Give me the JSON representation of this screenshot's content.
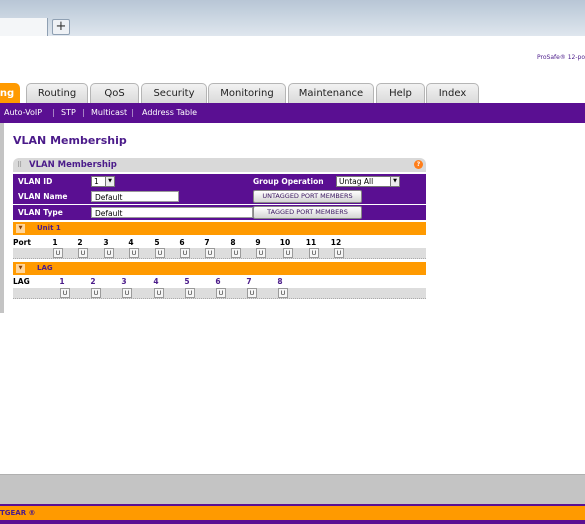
{
  "product_label": "ProSafe® 12-po",
  "main_tabs": [
    {
      "label": "ng",
      "active": true
    },
    {
      "label": "Routing",
      "active": false
    },
    {
      "label": "QoS",
      "active": false
    },
    {
      "label": "Security",
      "active": false
    },
    {
      "label": "Monitoring",
      "active": false
    },
    {
      "label": "Maintenance",
      "active": false
    },
    {
      "label": "Help",
      "active": false
    },
    {
      "label": "Index",
      "active": false
    }
  ],
  "subnav": {
    "items": [
      "Auto-VoIP",
      "STP",
      "Multicast",
      "Address Table"
    ],
    "separator": "|"
  },
  "page_title": "VLAN Membership",
  "panel": {
    "title": "VLAN Membership",
    "help_icon": "?",
    "vlan_id_label": "VLAN ID",
    "vlan_id_value": "1",
    "group_operation_label": "Group Operation",
    "group_operation_value": "Untag All",
    "vlan_name_label": "VLAN Name",
    "vlan_name_value": "Default",
    "vlan_type_label": "VLAN Type",
    "vlan_type_value": "Default",
    "untagged_button": "UNTAGGED PORT MEMBERS",
    "tagged_button": "TAGGED PORT MEMBERS"
  },
  "unit": {
    "section_label": "Unit 1",
    "row_label": "Port",
    "ports": [
      "1",
      "2",
      "3",
      "4",
      "5",
      "6",
      "7",
      "8",
      "9",
      "10",
      "11",
      "12"
    ],
    "states": [
      "U",
      "U",
      "U",
      "U",
      "U",
      "U",
      "U",
      "U",
      "U",
      "U",
      "U",
      "U"
    ]
  },
  "lag": {
    "section_label": "LAG",
    "row_label": "LAG",
    "lags": [
      "1",
      "2",
      "3",
      "4",
      "5",
      "6",
      "7",
      "8"
    ],
    "states": [
      "U",
      "U",
      "U",
      "U",
      "U",
      "U",
      "U",
      "U"
    ]
  },
  "footer_brand": "TGEAR ®",
  "colors": {
    "accent_purple": "#5a0f92",
    "accent_orange": "#ff9a00",
    "title_purple": "#4b1b8a"
  }
}
